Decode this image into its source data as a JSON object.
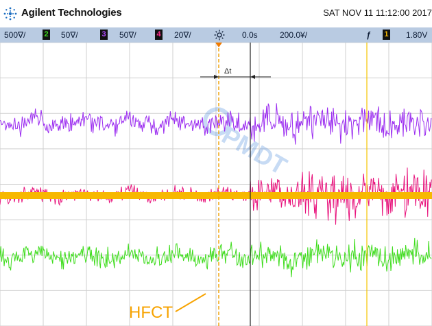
{
  "header": {
    "brand": "Agilent Technologies",
    "datetime": "SAT NOV 11 11:12:00 2017",
    "logo_icon": "agilent-spark-icon"
  },
  "toolbar": {
    "ch1_scale": "500∇/",
    "ch2_number": "2",
    "ch2_scale": "50∇/",
    "ch3_number": "3",
    "ch3_scale": "50∇/",
    "ch4_number": "4",
    "ch4_scale": "20∇/",
    "run_icon": "sun-trigger-icon",
    "delay": "0.0s",
    "timebase": "200.0¥/",
    "trigger_slope": "ƒ",
    "trigger_channel": "1",
    "trigger_level": "1.80V"
  },
  "screen": {
    "delta_label": "Δt",
    "annotation": "HFCT",
    "watermark": "PMDT"
  },
  "colors": {
    "toolbar_bg": "#b9cbe2",
    "ch1": "#f7b800",
    "ch2": "#3ddc1b",
    "ch3": "#9b2cf0",
    "ch4": "#e8127c",
    "annotation": "#f7a300",
    "cursor": "#f0a000"
  }
}
